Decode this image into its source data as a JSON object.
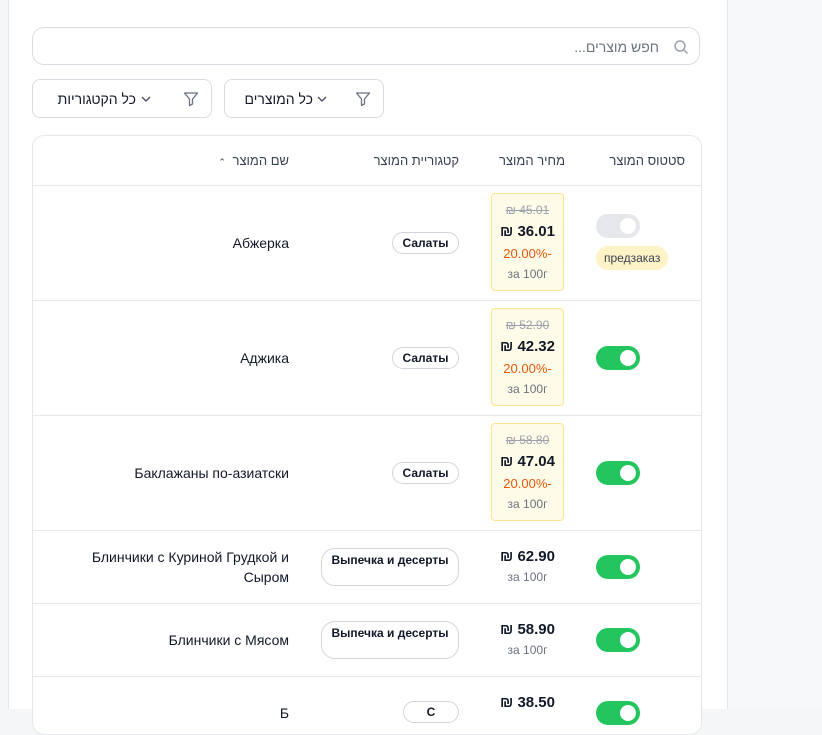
{
  "search": {
    "placeholder": "חפש מוצרים..."
  },
  "filters": {
    "products": "כל המוצרים",
    "categories": "כל הקטגוריות"
  },
  "table": {
    "headers": {
      "status": "סטטוס המוצר",
      "price": "מחיר המוצר",
      "category": "קטגוריית המוצר",
      "name": "שם המוצר"
    },
    "rows": [
      {
        "name": "Абжерка",
        "category": "Салаты",
        "old_price": "₪ 45.01",
        "price": "₪ 36.01",
        "discount": "20.00%-",
        "unit": "за 100г",
        "status_active": false,
        "badge": "предзаказ"
      },
      {
        "name": "Аджика",
        "category": "Салаты",
        "old_price": "₪ 52.90",
        "price": "₪ 42.32",
        "discount": "20.00%-",
        "unit": "за 100г",
        "status_active": true
      },
      {
        "name": "Баклажаны по-азиатски",
        "category": "Салаты",
        "old_price": "₪ 58.80",
        "price": "₪ 47.04",
        "discount": "20.00%-",
        "unit": "за 100г",
        "status_active": true
      },
      {
        "name": "Блинчики с Куриной Грудкой и Сыром",
        "category": "Выпечка и десерты",
        "price": "₪ 62.90",
        "unit": "за 100г",
        "status_active": true
      },
      {
        "name": "Блинчики с Мясом",
        "category": "Выпечка и десерты",
        "price": "₪ 58.90",
        "unit": "за 100г",
        "status_active": true
      },
      {
        "name": "Б",
        "category": "С",
        "price": "₪ 38.50",
        "status_active": true
      }
    ]
  }
}
